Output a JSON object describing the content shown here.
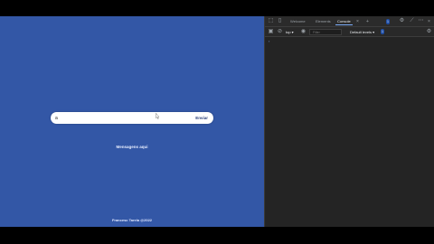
{
  "app": {
    "input": {
      "value": "a",
      "placeholder": ""
    },
    "send_label": "Enviar",
    "messages_link": "Mensagens aqui",
    "footer": "Francesc Tarela @2022"
  },
  "devtools": {
    "tabs": [
      {
        "label": "Welcome"
      },
      {
        "label": "Elements"
      },
      {
        "label": "Console"
      }
    ],
    "badges": {
      "issues": "1",
      "messages": "1"
    },
    "toolbar": {
      "context": "top ▾",
      "filter_placeholder": "Filter",
      "levels": "Default levels ▾",
      "level_badge": "1"
    },
    "prompt": "›"
  },
  "colors": {
    "app_background": "#3357a6",
    "devtools_background": "#242424",
    "accent": "#7cacf8"
  }
}
